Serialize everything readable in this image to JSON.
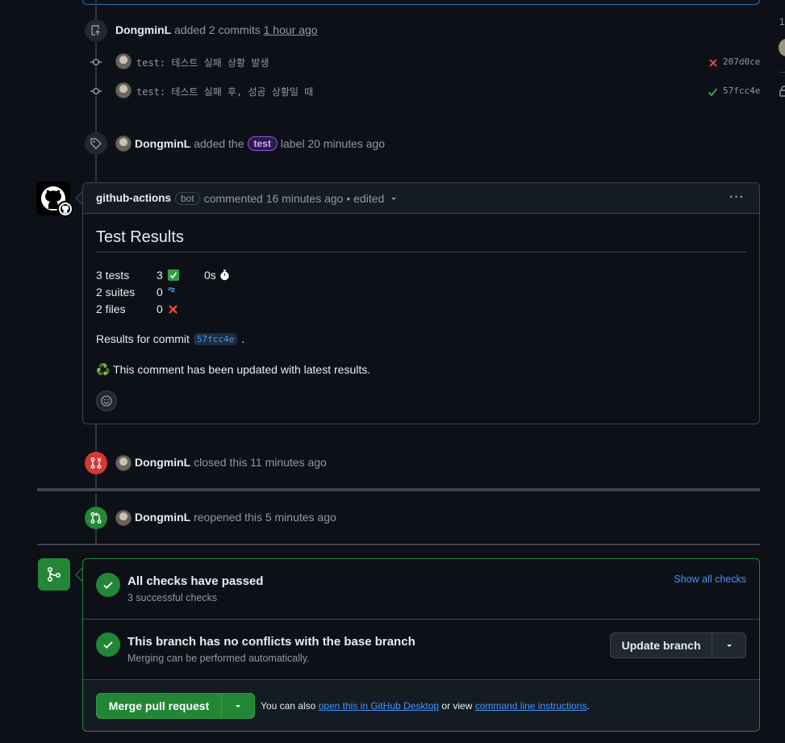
{
  "timeline": {
    "commits_event": {
      "actor": "DongminL",
      "action": "added 2 commits",
      "time": "1 hour ago",
      "commits": [
        {
          "message": "test: 테스트 실패 상황 발생",
          "sha": "207d0ce",
          "status": "failed"
        },
        {
          "message": "test: 테스트 실패 후, 성공 상황일 때",
          "sha": "57fcc4e",
          "status": "passed"
        }
      ]
    },
    "label_event": {
      "actor": "DongminL",
      "action_prefix": "added the",
      "label": "test",
      "action_suffix": "label 20 minutes ago"
    },
    "comment": {
      "author": "github-actions",
      "bot_badge": "bot",
      "meta": "commented 16 minutes ago • edited",
      "title": "Test Results",
      "stats": [
        {
          "label": "3 tests",
          "value": "3",
          "icon": "✅",
          "extra": "0s",
          "extra_icon": "⏱️"
        },
        {
          "label": "2 suites",
          "value": "0",
          "icon": "💤"
        },
        {
          "label": "2 files",
          "value": "0",
          "icon": "❌"
        }
      ],
      "results_prefix": "Results for commit",
      "results_sha": "57fcc4e",
      "results_suffix": ".",
      "updated_note": "♻️ This comment has been updated with latest results."
    },
    "closed_event": {
      "actor": "DongminL",
      "text": "closed this 11 minutes ago"
    },
    "reopened_event": {
      "actor": "DongminL",
      "text": "reopened this 5 minutes ago"
    }
  },
  "merge_box": {
    "checks": {
      "title": "All checks have passed",
      "subtitle": "3 successful checks",
      "link": "Show all checks"
    },
    "conflicts": {
      "title": "This branch has no conflicts with the base branch",
      "subtitle": "Merging can be performed automatically.",
      "update_button": "Update branch"
    },
    "merge": {
      "button": "Merge pull request",
      "prefix": "You can also",
      "link1": "open this in GitHub Desktop",
      "middle": "or view",
      "link2": "command line instructions",
      "suffix": "."
    }
  },
  "colors": {
    "accent_blue": "#4493f8",
    "success_green": "#238636",
    "danger_red": "#da3633",
    "label_purple": "#8957e5"
  }
}
